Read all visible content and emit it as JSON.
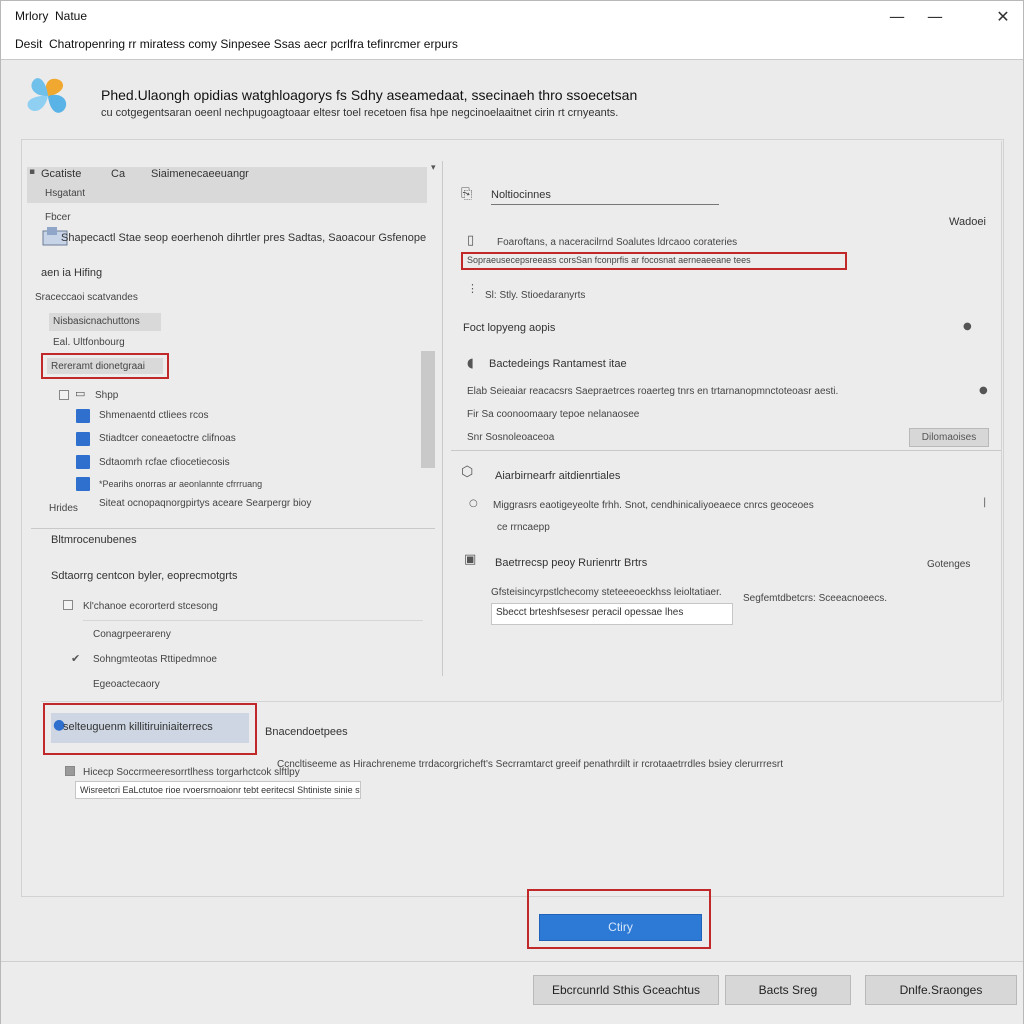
{
  "window": {
    "title_left": "Mrlory",
    "title_right": "Natue",
    "menu_label": "Desit",
    "menu_text": "Chatropenring rr miratess comy Sinpesee Ssas aecr pcrlfra tefinrcmer erpurs",
    "minimize": "—",
    "maximize": "—",
    "close": "✕"
  },
  "header": {
    "title": "Phed.Ulaongh opidias watghloagorys fs Sdhy aseamedaat, ssecinaeh thro ssoecetsan",
    "subtitle": "cu cotgegentsaran oeenl nechpugoagtoaar eltesr toel recetoen fisa hpe negcinoelaaitnet cirin rt crnyeants."
  },
  "left": {
    "tree_header": "Gcatiste",
    "tree_header_mid": "Ca",
    "tree_header_right": "Siaimenecaeeuangr",
    "item_1": "Hsgatant",
    "item_2": "Fbcer",
    "item_3": "Shapecactl Stae seop eoerhenoh dihrtler pres Sadtas, Saoacour Gsfenope",
    "section_1": "aen ia Hifing",
    "section_2": "Sraceccaoi scatvandes",
    "item_4": "Nisbasicnachuttons",
    "item_5": "Eal. Ultfonbourg",
    "selected_item": "Rereramt dionetgraai",
    "sub_group": "Shpp",
    "sub_1": "Shmenaentd ctliees rcos",
    "sub_2": "Stiadtcer coneaetoctre clifnoas",
    "sub_3": "Sdtaomrh rcfae cfiocetiecosis",
    "sub_4": "*Pearihs onorras ar aeonlannte cfrrruang",
    "row_label": "Hrides",
    "row_text": "Siteat ocnopaqnorgpirtys aceare Searpergr bioy",
    "section_3": "Bltmrocenubenes",
    "section_4": "Sdtaorrg centcon byler, eoprecmotgrts",
    "option_1": "Kl'chanoe ecororterd stcesong",
    "option_2": "Conagrpeerareny",
    "option_3": "Sohngmteotas Rttipedmnoe",
    "option_4": "Egeoactecaory"
  },
  "right": {
    "group_1": "Noltiocinnes",
    "side_label": "Wadoei",
    "field_1": "Foaroftans, a naceracilrnd Soalutes ldrcaoo corateries",
    "field_highlight": "Sopraeusecepsreeass corsSan fconprfis ar focosnat aerneaeeane tees",
    "field_2": "Sl: Stly. Stioedaranyrts",
    "row_2": "Foct lopyeng aopis",
    "group_2": "Bactedeings  Rantamest itae",
    "group_2_line": "Elab Seieaiar reacacsrs Saepraetrces roaerteg tnrs en trtarnanopmnctoteoasr aesti.",
    "group_2_line2": "Fir Sa coonoomaary tepoe nelanaosee",
    "group_2_line3": "Snr Sosnoleoaceoa",
    "group_2_button": "Dilomaoises",
    "group_3": "Aiarbirnearfr aitdienrtiales",
    "group_3_line": "Miggrasrs eaotigeyeolte frhh. Snot, cendhinicaliyoeaece cnrcs geoceoes",
    "group_3_line2": "ce rrncaepp",
    "group_4": "Baetrrecsp peoy Rurienrtr Brtrs",
    "group_4_side": "Gotenges",
    "group_4_line": "Gfsteisincyrpstlchecomy steteeeoeckhss leioltatiaer.",
    "group_4_line_right": "Segfemtdbetcrs: Sceeacnoeecs.",
    "group_4_input": "Sbecct brteshfsesesr peracil opessae lhes"
  },
  "bottom": {
    "highlight_button": "selteuguenm killitiruiniaiterrecs",
    "side_label": "Bnacendoetpees",
    "desc": "Ccncltiseeme as Hirachreneme trrdacorgricheft's Secrramtarct greeif penathrdilt ir rcrotaaetrrdles bsiey clerurrresrt",
    "check_label": "Hicecp Soccrmeeresorrtlhess torgarhctcok slftlpy",
    "input_text": "Wisreetcri EaLctutoe rioe rvoersrnoaionr tebt eeritecsl Shtiniste sinie sfrgipe"
  },
  "primary_button": "Ctiry",
  "footer": {
    "btn_1": "Ebcrcunrld Sthis Gceachtus",
    "btn_2": "Bacts  Sreg",
    "btn_3": "Dnlfe.Sraonges"
  },
  "colors": {
    "accent": "#2d7ad6",
    "highlight": "#c0282a",
    "background": "#ebebec"
  }
}
